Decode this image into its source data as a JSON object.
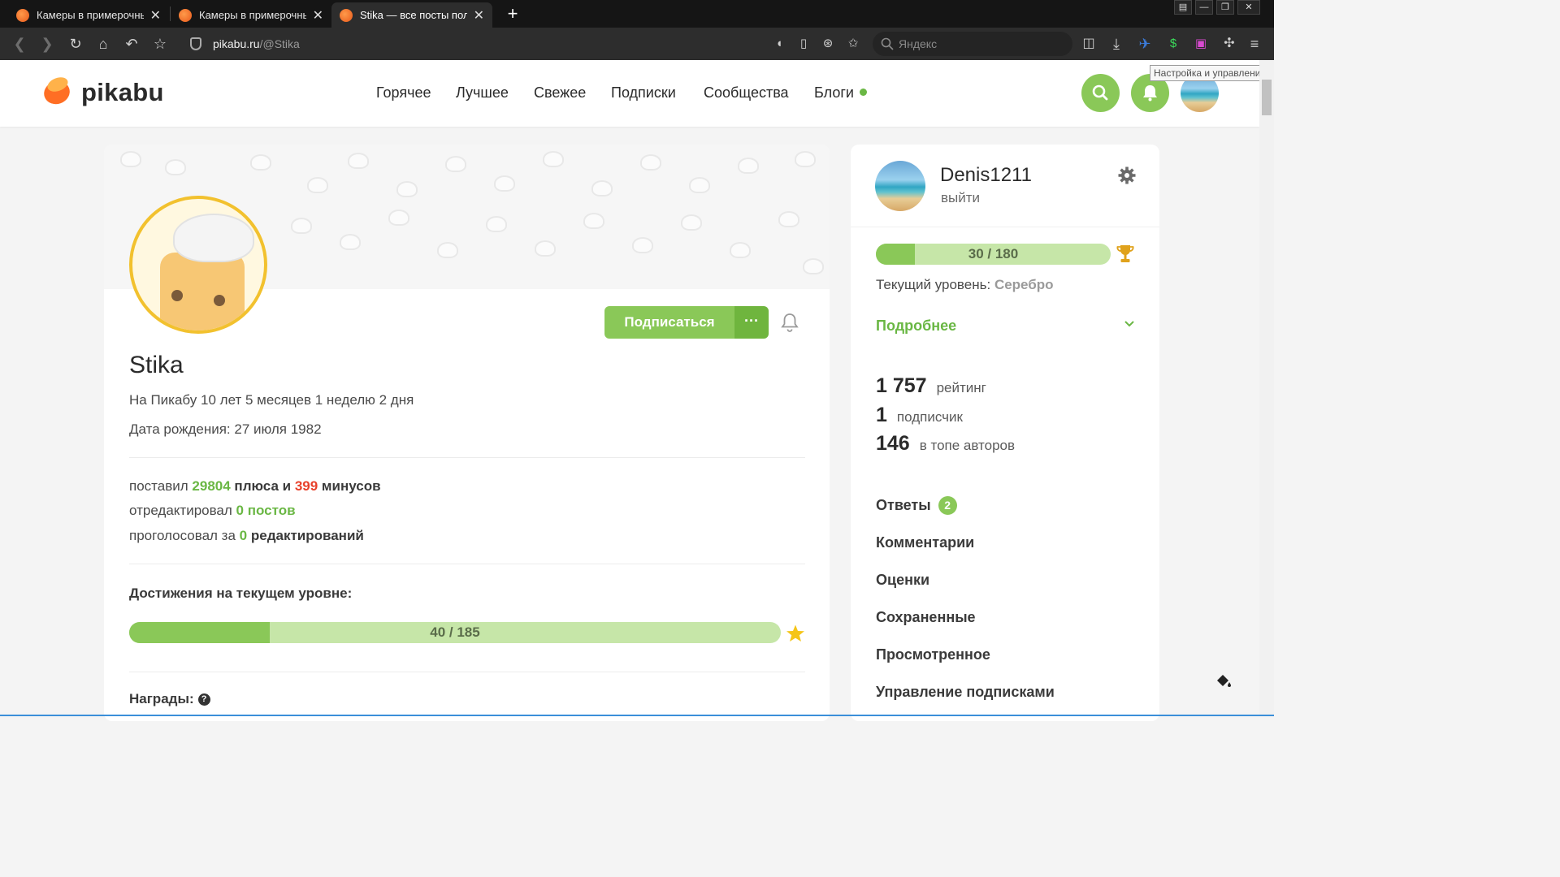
{
  "browser": {
    "tabs": [
      {
        "title": "Камеры в примерочны",
        "active": false
      },
      {
        "title": "Камеры в примерочны",
        "active": false
      },
      {
        "title": "Stika — все посты поль",
        "active": true
      }
    ],
    "new_tab": "+",
    "close_glyph": "✕",
    "url_host": "pikabu.ru",
    "url_path": "/@Stika",
    "search_placeholder": "Яндекс",
    "tooltip": "Настройка и управление",
    "window_controls": [
      "▤",
      "—",
      "❐",
      "✕"
    ]
  },
  "site": {
    "logo": "pikabu",
    "nav": [
      "Горячее",
      "Лучшее",
      "Свежее",
      "Подписки",
      "Сообщества",
      "Блоги"
    ]
  },
  "profile": {
    "username": "Stika",
    "on_site": "На Пикабу 10 лет 5 месяцев 1 неделю 2 дня",
    "birthday": "Дата рождения: 27 июля 1982",
    "subscribe_label": "Подписаться",
    "more_label": "···",
    "stats": {
      "line1": {
        "a": "поставил",
        "plus": "29804",
        "b": "плюса и",
        "minus": "399",
        "c": "минусов"
      },
      "line2": {
        "a": "отредактировал",
        "v": "0 постов"
      },
      "line3": {
        "a": "проголосовал за",
        "v": "0",
        "b": "редактирований"
      }
    },
    "achievements_title": "Достижения на текущем уровне:",
    "achievements": {
      "current": 40,
      "total": 185,
      "label": "40 / 185"
    },
    "awards_label": "Награды:",
    "awards_help": "?"
  },
  "sidebar": {
    "username": "Denis1211",
    "logout": "выйти",
    "level_progress": {
      "current": 30,
      "total": 180,
      "label": "30 / 180"
    },
    "level_label": "Текущий уровень:",
    "level_value": "Серебро",
    "more_label": "Подробнее",
    "numbers": [
      {
        "value": "1 757",
        "label": "рейтинг"
      },
      {
        "value": "1",
        "label": "подписчик"
      },
      {
        "value": "146",
        "label": "в топе авторов"
      }
    ],
    "menu": [
      {
        "label": "Ответы",
        "badge": "2"
      },
      {
        "label": "Комментарии"
      },
      {
        "label": "Оценки"
      },
      {
        "label": "Сохраненные"
      },
      {
        "label": "Просмотренное"
      },
      {
        "label": "Управление подписками"
      }
    ]
  },
  "colors": {
    "accent": "#8ac858",
    "accent_dark": "#6ab744",
    "minus": "#e8412b",
    "browser_bg": "#2d2d2d"
  }
}
